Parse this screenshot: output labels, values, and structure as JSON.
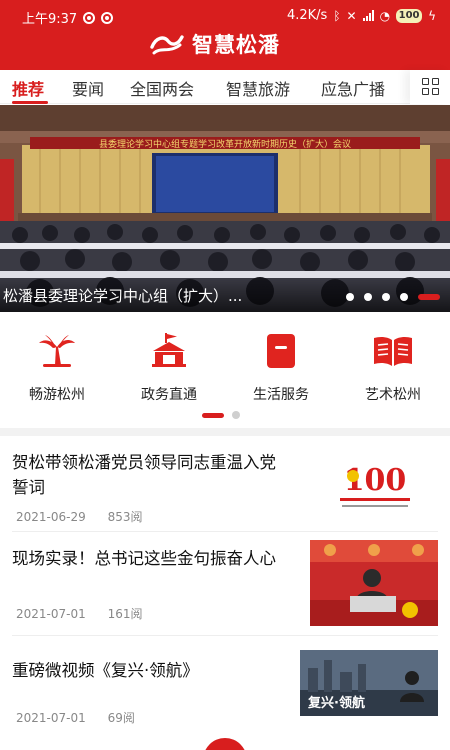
{
  "status_bar": {
    "time": "上午9:37",
    "speed": "4.2K/s",
    "battery": "100"
  },
  "app": {
    "title": "智慧松潘"
  },
  "tabs": [
    {
      "label": "推荐",
      "active": true
    },
    {
      "label": "要闻",
      "active": false
    },
    {
      "label": "全国两会",
      "active": false
    },
    {
      "label": "智慧旅游",
      "active": false
    },
    {
      "label": "应急广播",
      "active": false
    }
  ],
  "banner": {
    "screen_banner": "县委理论学习中心组专题学习改革开放新时期历史（扩大）会议",
    "caption": "松潘县委理论学习中心组（扩大）...",
    "slide_count": 5,
    "active_slide": 5
  },
  "services": [
    {
      "label": "畅游松州",
      "icon": "palm-tree-icon"
    },
    {
      "label": "政务直通",
      "icon": "government-building-icon"
    },
    {
      "label": "生活服务",
      "icon": "bookmark-icon"
    },
    {
      "label": "艺术松州",
      "icon": "open-book-icon"
    }
  ],
  "services_pages": 2,
  "services_active_page": 1,
  "news": [
    {
      "title": "贺松带领松潘党员领导同志重温入党誓词",
      "date": "2021-06-29",
      "reads": "853阅",
      "thumb_text": "100"
    },
    {
      "title": "现场实录！总书记这些金句振奋人心",
      "date": "2021-07-01",
      "reads": "161阅"
    },
    {
      "title": "重磅微视频《复兴·领航》",
      "date": "2021-07-01",
      "reads": "69阅",
      "thumb_text": "复兴·领航"
    }
  ],
  "colors": {
    "brand": "#d81e1e",
    "muted": "#888888"
  }
}
